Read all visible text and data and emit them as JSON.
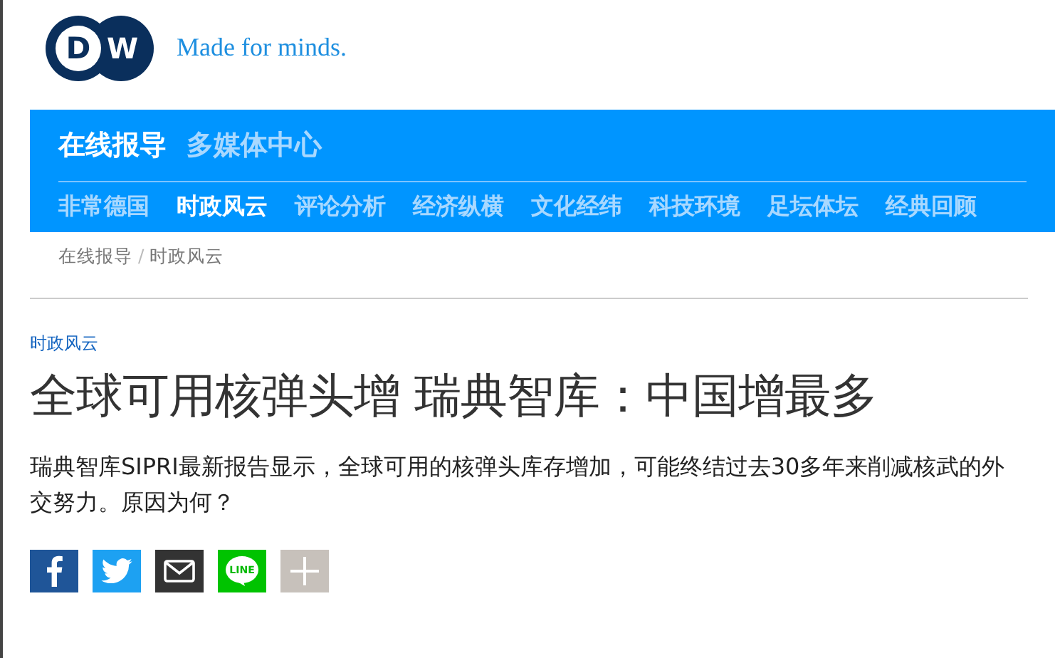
{
  "logo": {
    "letters": [
      "D",
      "W"
    ],
    "tagline": "Made for minds."
  },
  "nav": {
    "sections": [
      {
        "label": "在线报导",
        "selected": true
      },
      {
        "label": "多媒体中心",
        "selected": false
      }
    ],
    "categories": [
      {
        "label": "非常德国",
        "selected": false
      },
      {
        "label": "时政风云",
        "selected": true
      },
      {
        "label": "评论分析",
        "selected": false
      },
      {
        "label": "经济纵横",
        "selected": false
      },
      {
        "label": "文化经纬",
        "selected": false
      },
      {
        "label": "科技环境",
        "selected": false
      },
      {
        "label": "足坛体坛",
        "selected": false
      },
      {
        "label": "经典回顾",
        "selected": false
      }
    ]
  },
  "breadcrumb": [
    "在线报导",
    "时政风云"
  ],
  "breadcrumb_separator": "/",
  "article": {
    "category": "时政风云",
    "title": "全球可用核弹头增 瑞典智库：中国增最多",
    "teaser": "瑞典智库SIPRI最新报告显示，全球可用的核弹头库存增加，可能终结过去30多年来削减核武的外交努力。原因为何？"
  },
  "share": [
    {
      "kind": "facebook"
    },
    {
      "kind": "twitter"
    },
    {
      "kind": "email"
    },
    {
      "kind": "line",
      "text": "LINE"
    },
    {
      "kind": "more"
    }
  ]
}
